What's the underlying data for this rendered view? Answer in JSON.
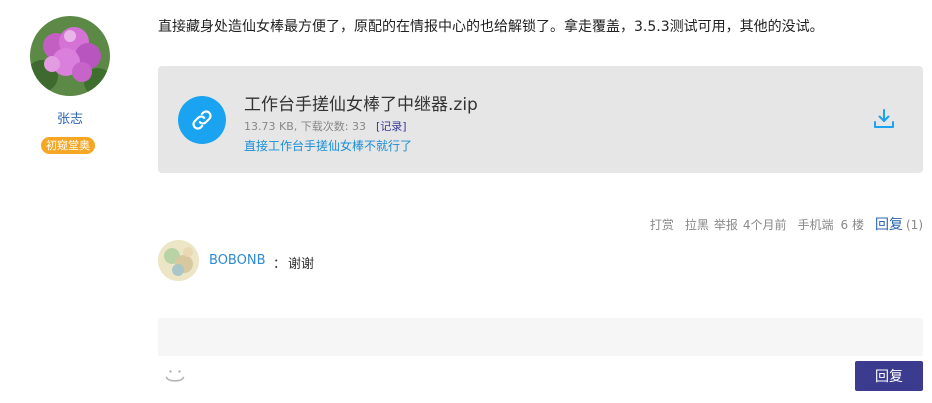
{
  "author": {
    "name": "张志",
    "level": "初窥堂奥",
    "avatar": "flower-avatar"
  },
  "post": {
    "text": "直接藏身处造仙女棒最方便了，原配的在情报中心的也给解锁了。拿走覆盖，3.5.3测试可用，其他的没试。"
  },
  "attachment": {
    "icon": "link-icon",
    "filename": "工作台手搓仙女棒了中继器.zip",
    "meta": "13.73 KB, 下载次数:  33",
    "record_label": "[记录]",
    "description": "直接工作台手搓仙女棒不就行了",
    "download_icon": "download-icon",
    "accent_color": "#1aa3f0"
  },
  "meta": {
    "tip": "打赏",
    "block": "拉黑",
    "report": "举报",
    "time": "4个月前",
    "device": "手机端",
    "floor": "6 楼",
    "reply_label": "回复",
    "reply_count": "(1)"
  },
  "comment": {
    "user": "BOBONB",
    "colon": "：",
    "text": "谢谢"
  },
  "reply_form": {
    "placeholder": "",
    "emoji_icon": "smiley-icon",
    "submit_label": "回复",
    "button_color": "#3b3b8f"
  }
}
